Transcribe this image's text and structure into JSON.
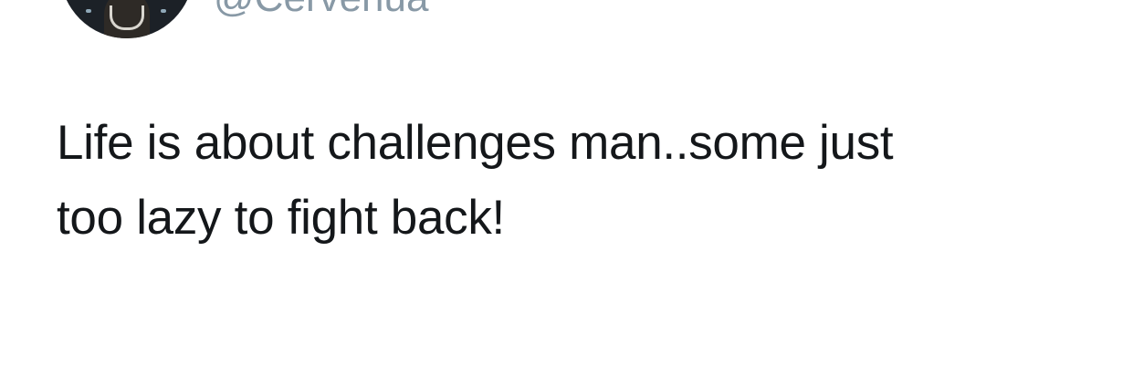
{
  "author": {
    "handle": "@Cervenua"
  },
  "tweet": {
    "lines": [
      "Life is about challenges man..some just",
      "too lazy to fight back!"
    ]
  }
}
